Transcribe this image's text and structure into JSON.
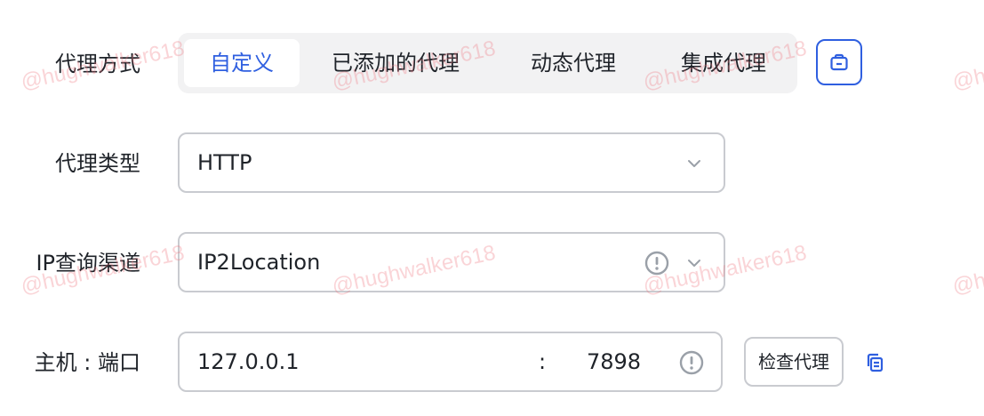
{
  "proxy_mode": {
    "label": "代理方式",
    "options": [
      "自定义",
      "已添加的代理",
      "动态代理",
      "集成代理"
    ],
    "selected": "自定义"
  },
  "proxy_type": {
    "label": "代理类型",
    "value": "HTTP"
  },
  "ip_channel": {
    "label": "IP查询渠道",
    "value": "IP2Location"
  },
  "host_port": {
    "label": "主机 : 端口",
    "host": "127.0.0.1",
    "separator": ":",
    "port": "7898",
    "check_label": "检查代理"
  },
  "watermark": "@hughwalker618",
  "colors": {
    "accent": "#2f5fe0",
    "border": "#c9cbd0",
    "segment_bg": "#f2f2f3"
  },
  "icons": [
    "bag-icon",
    "chevron-down-icon",
    "warning-icon",
    "copy-icon"
  ]
}
